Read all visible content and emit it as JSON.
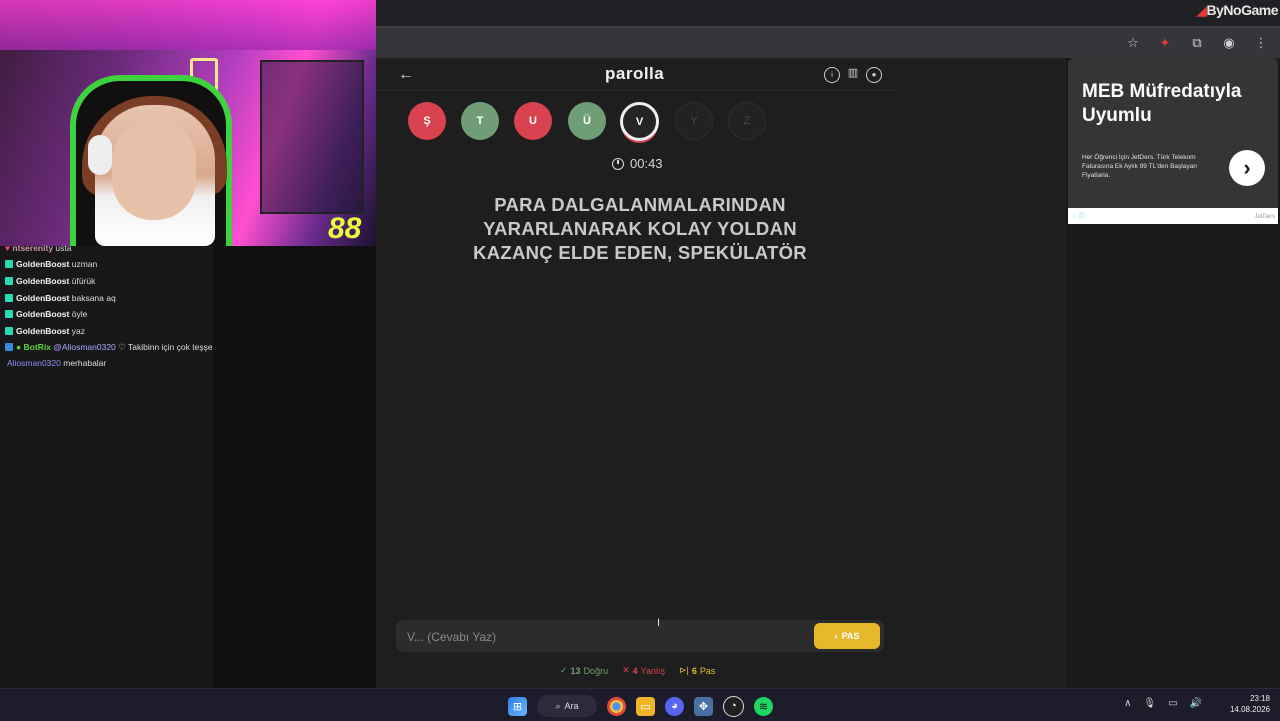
{
  "browser": {
    "brand": "ByNoGame"
  },
  "webcam": {
    "counter": "88"
  },
  "chat": {
    "messages": [
      {
        "user": "ntserenity",
        "text": "usta",
        "style": "partial"
      },
      {
        "user": "GoldenBoost",
        "text": "uzman"
      },
      {
        "user": "GoldenBoost",
        "text": "üfürük"
      },
      {
        "user": "GoldenBoost",
        "text": "baksana aq"
      },
      {
        "user": "GoldenBoost",
        "text": "öyle"
      },
      {
        "user": "GoldenBoost",
        "text": "yaz"
      },
      {
        "user": "BotRix",
        "mention": "@Aliosman0320",
        "text": "♡ Takibinn için çok teşşekür ederim ♡"
      },
      {
        "user": "Aliosman0320",
        "text": "merhabalar"
      }
    ]
  },
  "game": {
    "title": "parolla",
    "back_icon": "←",
    "letters": [
      {
        "char": "Ş",
        "state": "wrong"
      },
      {
        "char": "T",
        "state": "correct"
      },
      {
        "char": "U",
        "state": "wrong"
      },
      {
        "char": "Ü",
        "state": "correct"
      },
      {
        "char": "V",
        "state": "current"
      },
      {
        "char": "Y",
        "state": "pending"
      },
      {
        "char": "Z",
        "state": "pending"
      }
    ],
    "timer": "00:43",
    "question": "PARA DALGALANMALARINDAN YARARLANARAK KOLAY YOLDAN KAZANÇ ELDE EDEN, SPEKÜLATÖR",
    "answer_placeholder": "V... (Cevabı Yaz)",
    "pass_button": "PAS",
    "stats": {
      "correct_count": "13",
      "correct_label": "Doğru",
      "wrong_count": "4",
      "wrong_label": "Yanlış",
      "pass_count": "6",
      "pass_label": "Pas"
    }
  },
  "ad": {
    "title": "MEB Müfredatıyla Uyumlu",
    "text": "Her Öğrenci İçin JetDers. Türk Telekom Faturasına Ek Aylık 99 TL'den Başlayan Fiyatlarla.",
    "advertiser": "JetDers"
  },
  "taskbar": {
    "search_label": "Ara",
    "time": "23:18",
    "date": "14.08.2026"
  },
  "colors": {
    "correct": "#6f9d76",
    "wrong": "#d9424f",
    "pass": "#e6b92c"
  }
}
